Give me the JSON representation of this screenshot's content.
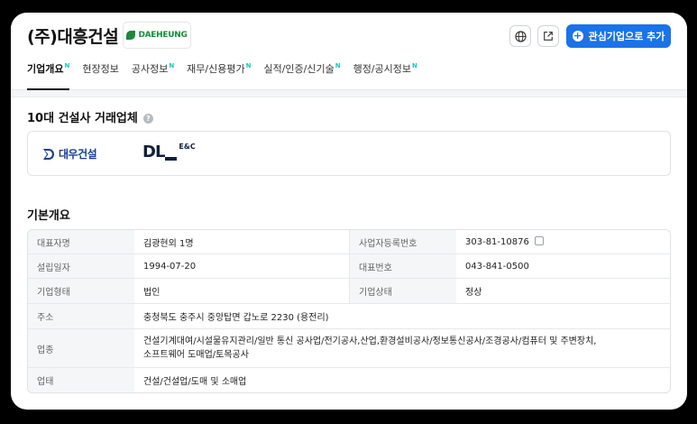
{
  "header": {
    "company_name": "(주)대흥건설",
    "logo_text": "DAEHEUNG",
    "add_button_label": "관심기업으로 추가",
    "add_button_icon": "plus-circle-icon",
    "accent_color": "#1a73e8"
  },
  "tabs": [
    {
      "label": "기업개요",
      "badge": "N",
      "active": true
    },
    {
      "label": "현장정보",
      "badge": "",
      "active": false
    },
    {
      "label": "공사정보",
      "badge": "N",
      "active": false
    },
    {
      "label": "재무/신용평가",
      "badge": "N",
      "active": false
    },
    {
      "label": "실적/인증/신기술",
      "badge": "N",
      "active": false
    },
    {
      "label": "행정/공시정보",
      "badge": "N",
      "active": false
    }
  ],
  "partners_section": {
    "title": "10대 건설사 거래업체",
    "partners": [
      {
        "name": "대우건설"
      },
      {
        "name": "DL",
        "suffix": "E&C"
      }
    ]
  },
  "basic_section": {
    "title": "기본개요",
    "rows": {
      "ceo_label": "대표자명",
      "ceo_value": "김광현외 1명",
      "bizno_label": "사업자등록번호",
      "bizno_value": "303-81-10876",
      "founded_label": "설립일자",
      "founded_value": "1994-07-20",
      "phone_label": "대표번호",
      "phone_value": "043-841-0500",
      "type_label": "기업형태",
      "type_value": "법인",
      "status_label": "기업상태",
      "status_value": "정상",
      "address_label": "주소",
      "address_value": "충청북도 충주시 중앙탑면 갑노로 2230 (용전리)",
      "industry_label": "업종",
      "industry_value_1": "건설기계대여/시설물유지관리/일반 통신 공사업/전기공사,산업,환경설비공사/정보통신공사/조경공사/컴퓨터 및 주변장치,",
      "industry_value_2": "소프트웨어 도매업/토목공사",
      "business_label": "업태",
      "business_value": "건설/건설업/도매 및 소매업"
    }
  }
}
